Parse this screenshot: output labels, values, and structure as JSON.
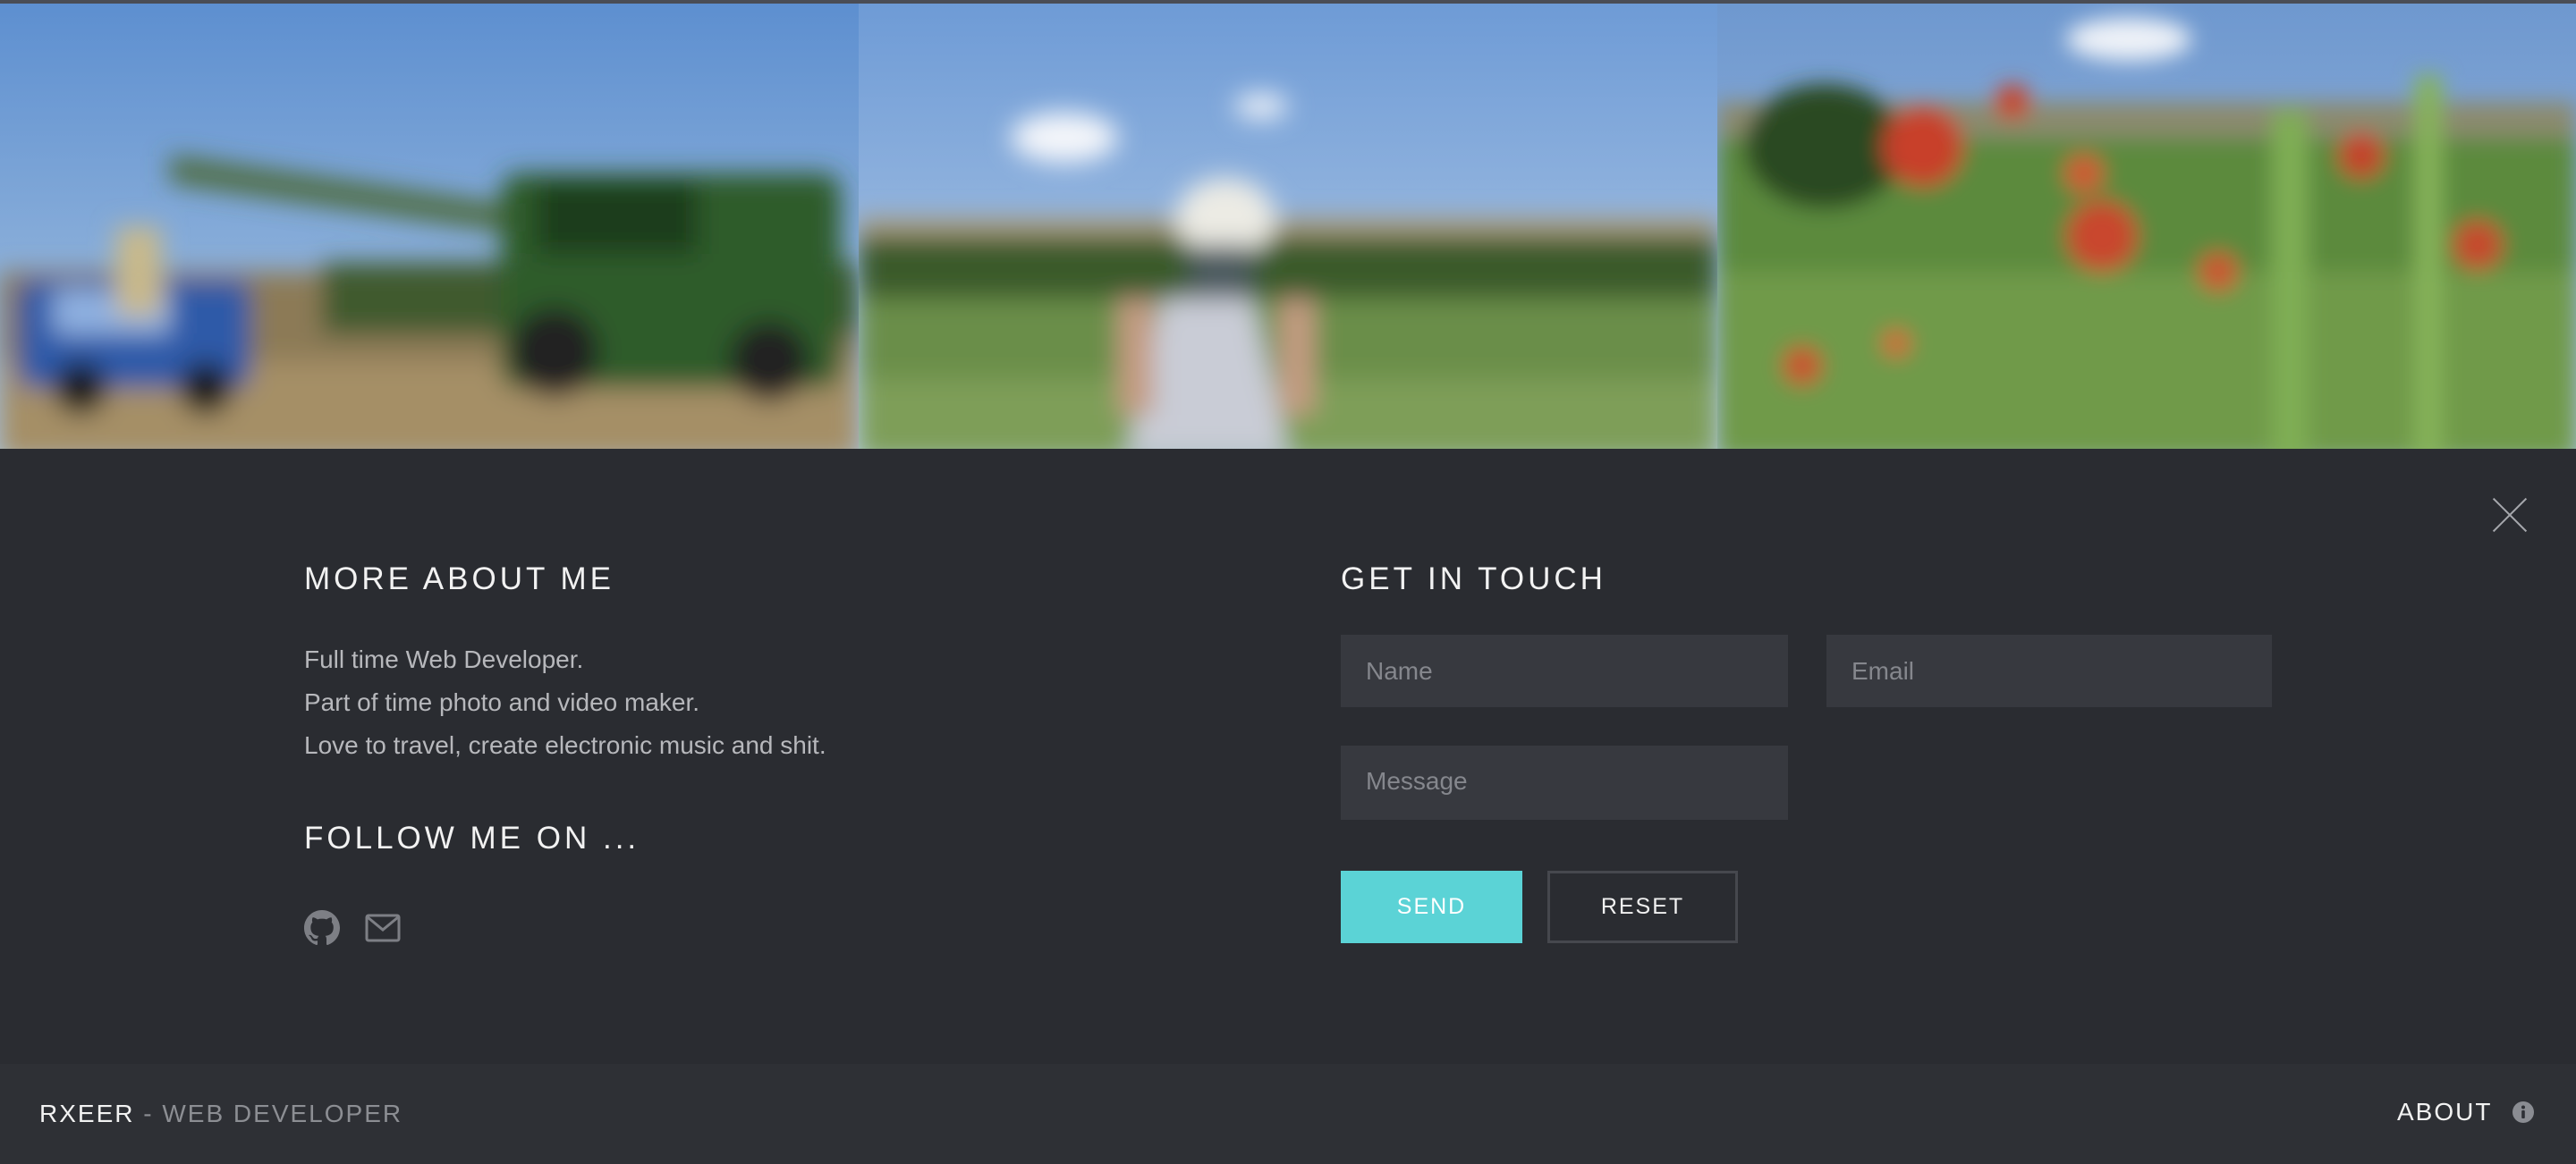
{
  "about": {
    "heading": "MORE ABOUT ME",
    "lines": [
      "Full time Web Developer.",
      "Part of time photo and video maker.",
      "Love to travel, create electronic music and shit."
    ]
  },
  "follow": {
    "heading": "FOLLOW ME ON ...",
    "icons": [
      "github-icon",
      "mail-icon"
    ]
  },
  "contact": {
    "heading": "GET IN TOUCH",
    "name_placeholder": "Name",
    "email_placeholder": "Email",
    "message_placeholder": "Message",
    "send_label": "SEND",
    "reset_label": "RESET"
  },
  "footer": {
    "brand": "RXEER",
    "separator": " - ",
    "tagline": "WEB DEVELOPER",
    "about_label": "ABOUT"
  },
  "colors": {
    "accent": "#5bd3d6",
    "overlay": "#2a2c31",
    "footer": "#2e3035"
  }
}
